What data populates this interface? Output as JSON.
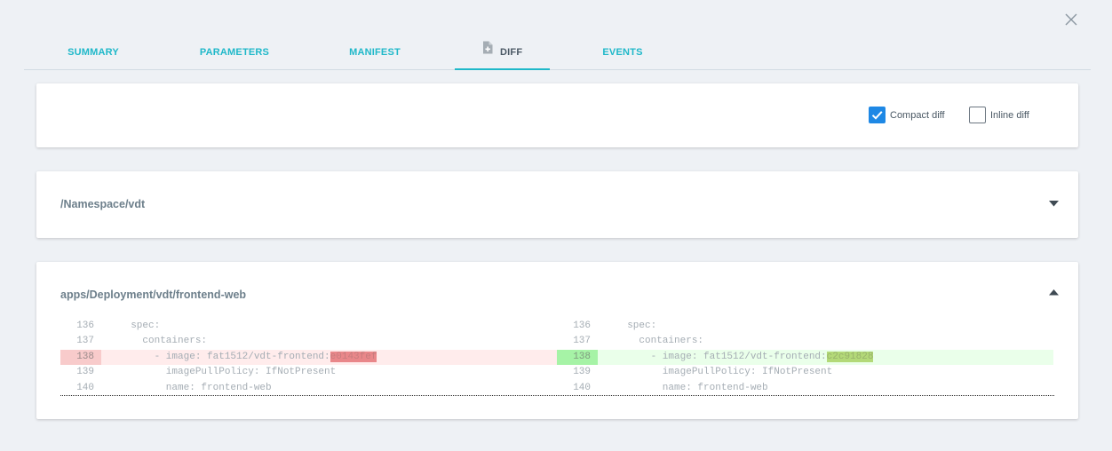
{
  "tabs": [
    {
      "label": "SUMMARY",
      "active": false
    },
    {
      "label": "PARAMETERS",
      "active": false
    },
    {
      "label": "MANIFEST",
      "active": false
    },
    {
      "label": "DIFF",
      "active": true,
      "icon": "file-plus-icon"
    },
    {
      "label": "EVENTS",
      "active": false
    }
  ],
  "options": {
    "compact_label": "Compact diff",
    "compact_checked": true,
    "inline_label": "Inline diff",
    "inline_checked": false
  },
  "resources": [
    {
      "title": "/Namespace/vdt",
      "expanded": false,
      "chevron": "chevron-down-icon"
    },
    {
      "title": "apps/Deployment/vdt/frontend-web",
      "expanded": true,
      "chevron": "chevron-up-icon"
    }
  ],
  "diff": {
    "left": [
      {
        "num": "136",
        "type": "context",
        "pre": "  spec:",
        "hl": "",
        "post": ""
      },
      {
        "num": "137",
        "type": "context",
        "pre": "    containers:",
        "hl": "",
        "post": ""
      },
      {
        "num": "138",
        "type": "removed",
        "pre": "      - image: fat1512/vdt-frontend:",
        "hl": "e0143fef",
        "post": ""
      },
      {
        "num": "139",
        "type": "context",
        "pre": "        imagePullPolicy: IfNotPresent",
        "hl": "",
        "post": ""
      },
      {
        "num": "140",
        "type": "context",
        "pre": "        name: frontend-web",
        "hl": "",
        "post": ""
      }
    ],
    "right": [
      {
        "num": "136",
        "type": "context",
        "pre": "  spec:",
        "hl": "",
        "post": ""
      },
      {
        "num": "137",
        "type": "context",
        "pre": "    containers:",
        "hl": "",
        "post": ""
      },
      {
        "num": "138",
        "type": "added",
        "pre": "      - image: fat1512/vdt-frontend:",
        "hl": "c2c91828",
        "post": ""
      },
      {
        "num": "139",
        "type": "context",
        "pre": "        imagePullPolicy: IfNotPresent",
        "hl": "",
        "post": ""
      },
      {
        "num": "140",
        "type": "context",
        "pre": "        name: frontend-web",
        "hl": "",
        "post": ""
      }
    ]
  },
  "colors": {
    "accent": "#1fb8c9",
    "checkbox": "#1e88e5",
    "removed_bg": "#ffecec",
    "added_bg": "#eaffea"
  }
}
